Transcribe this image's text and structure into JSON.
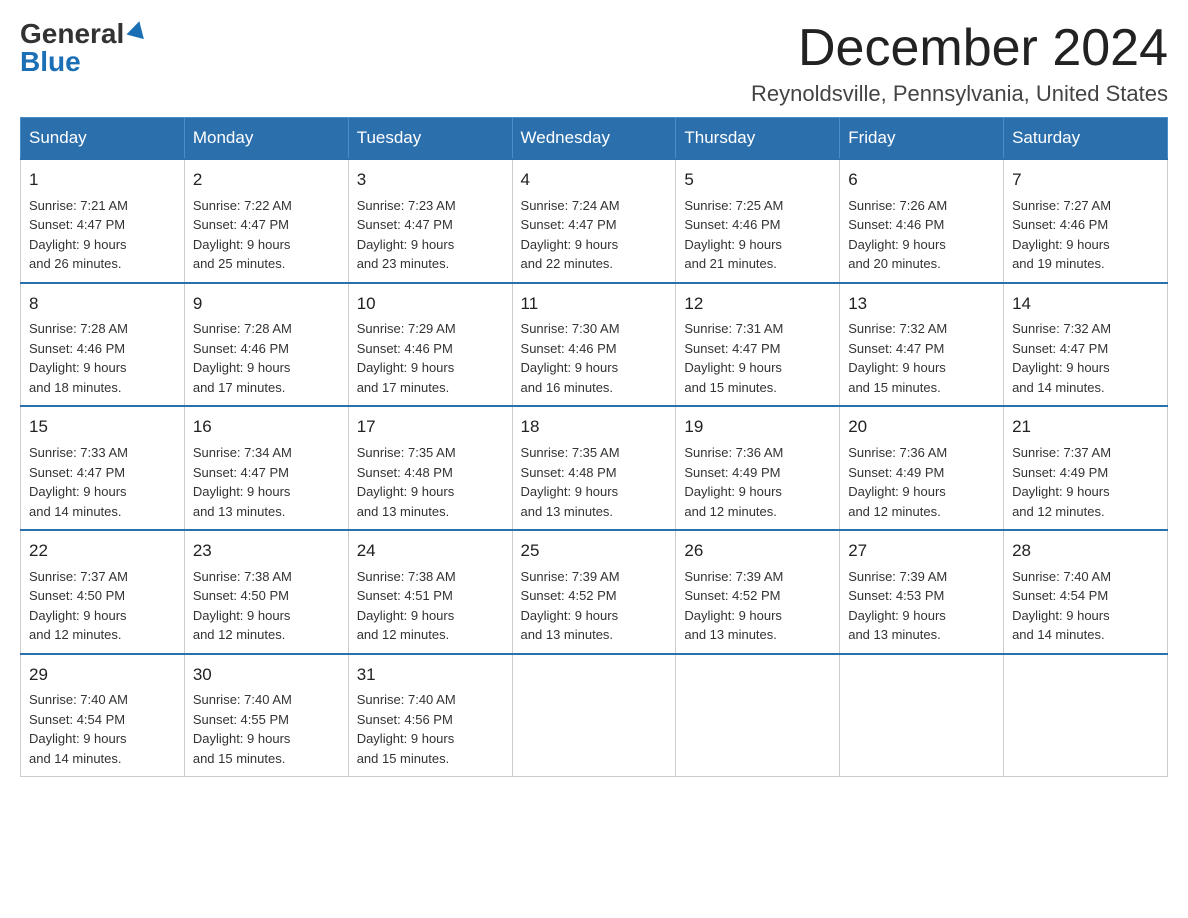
{
  "logo": {
    "general": "General",
    "blue": "Blue"
  },
  "title": {
    "month": "December 2024",
    "location": "Reynoldsville, Pennsylvania, United States"
  },
  "headers": [
    "Sunday",
    "Monday",
    "Tuesday",
    "Wednesday",
    "Thursday",
    "Friday",
    "Saturday"
  ],
  "weeks": [
    [
      {
        "day": "1",
        "sunrise": "7:21 AM",
        "sunset": "4:47 PM",
        "daylight": "9 hours and 26 minutes."
      },
      {
        "day": "2",
        "sunrise": "7:22 AM",
        "sunset": "4:47 PM",
        "daylight": "9 hours and 25 minutes."
      },
      {
        "day": "3",
        "sunrise": "7:23 AM",
        "sunset": "4:47 PM",
        "daylight": "9 hours and 23 minutes."
      },
      {
        "day": "4",
        "sunrise": "7:24 AM",
        "sunset": "4:47 PM",
        "daylight": "9 hours and 22 minutes."
      },
      {
        "day": "5",
        "sunrise": "7:25 AM",
        "sunset": "4:46 PM",
        "daylight": "9 hours and 21 minutes."
      },
      {
        "day": "6",
        "sunrise": "7:26 AM",
        "sunset": "4:46 PM",
        "daylight": "9 hours and 20 minutes."
      },
      {
        "day": "7",
        "sunrise": "7:27 AM",
        "sunset": "4:46 PM",
        "daylight": "9 hours and 19 minutes."
      }
    ],
    [
      {
        "day": "8",
        "sunrise": "7:28 AM",
        "sunset": "4:46 PM",
        "daylight": "9 hours and 18 minutes."
      },
      {
        "day": "9",
        "sunrise": "7:28 AM",
        "sunset": "4:46 PM",
        "daylight": "9 hours and 17 minutes."
      },
      {
        "day": "10",
        "sunrise": "7:29 AM",
        "sunset": "4:46 PM",
        "daylight": "9 hours and 17 minutes."
      },
      {
        "day": "11",
        "sunrise": "7:30 AM",
        "sunset": "4:46 PM",
        "daylight": "9 hours and 16 minutes."
      },
      {
        "day": "12",
        "sunrise": "7:31 AM",
        "sunset": "4:47 PM",
        "daylight": "9 hours and 15 minutes."
      },
      {
        "day": "13",
        "sunrise": "7:32 AM",
        "sunset": "4:47 PM",
        "daylight": "9 hours and 15 minutes."
      },
      {
        "day": "14",
        "sunrise": "7:32 AM",
        "sunset": "4:47 PM",
        "daylight": "9 hours and 14 minutes."
      }
    ],
    [
      {
        "day": "15",
        "sunrise": "7:33 AM",
        "sunset": "4:47 PM",
        "daylight": "9 hours and 14 minutes."
      },
      {
        "day": "16",
        "sunrise": "7:34 AM",
        "sunset": "4:47 PM",
        "daylight": "9 hours and 13 minutes."
      },
      {
        "day": "17",
        "sunrise": "7:35 AM",
        "sunset": "4:48 PM",
        "daylight": "9 hours and 13 minutes."
      },
      {
        "day": "18",
        "sunrise": "7:35 AM",
        "sunset": "4:48 PM",
        "daylight": "9 hours and 13 minutes."
      },
      {
        "day": "19",
        "sunrise": "7:36 AM",
        "sunset": "4:49 PM",
        "daylight": "9 hours and 12 minutes."
      },
      {
        "day": "20",
        "sunrise": "7:36 AM",
        "sunset": "4:49 PM",
        "daylight": "9 hours and 12 minutes."
      },
      {
        "day": "21",
        "sunrise": "7:37 AM",
        "sunset": "4:49 PM",
        "daylight": "9 hours and 12 minutes."
      }
    ],
    [
      {
        "day": "22",
        "sunrise": "7:37 AM",
        "sunset": "4:50 PM",
        "daylight": "9 hours and 12 minutes."
      },
      {
        "day": "23",
        "sunrise": "7:38 AM",
        "sunset": "4:50 PM",
        "daylight": "9 hours and 12 minutes."
      },
      {
        "day": "24",
        "sunrise": "7:38 AM",
        "sunset": "4:51 PM",
        "daylight": "9 hours and 12 minutes."
      },
      {
        "day": "25",
        "sunrise": "7:39 AM",
        "sunset": "4:52 PM",
        "daylight": "9 hours and 13 minutes."
      },
      {
        "day": "26",
        "sunrise": "7:39 AM",
        "sunset": "4:52 PM",
        "daylight": "9 hours and 13 minutes."
      },
      {
        "day": "27",
        "sunrise": "7:39 AM",
        "sunset": "4:53 PM",
        "daylight": "9 hours and 13 minutes."
      },
      {
        "day": "28",
        "sunrise": "7:40 AM",
        "sunset": "4:54 PM",
        "daylight": "9 hours and 14 minutes."
      }
    ],
    [
      {
        "day": "29",
        "sunrise": "7:40 AM",
        "sunset": "4:54 PM",
        "daylight": "9 hours and 14 minutes."
      },
      {
        "day": "30",
        "sunrise": "7:40 AM",
        "sunset": "4:55 PM",
        "daylight": "9 hours and 15 minutes."
      },
      {
        "day": "31",
        "sunrise": "7:40 AM",
        "sunset": "4:56 PM",
        "daylight": "9 hours and 15 minutes."
      },
      null,
      null,
      null,
      null
    ]
  ]
}
